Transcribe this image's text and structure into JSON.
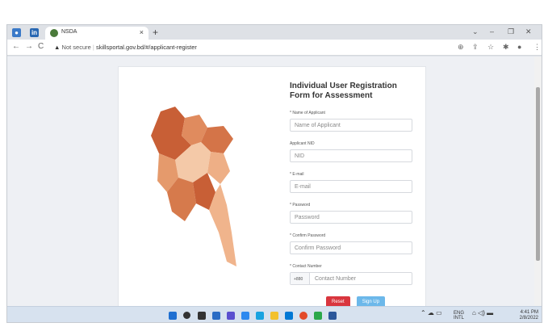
{
  "browser": {
    "tab_title": "NSDA",
    "tab_close": "×",
    "new_tab": "+",
    "window_controls": [
      "⌄",
      "–",
      "❐",
      "✕"
    ],
    "not_secure": "Not secure",
    "url": "skillsportal.gov.bd/#/applicant-register",
    "nav_back": "←",
    "nav_forward": "→",
    "nav_reload": "C",
    "toolbar_icons": [
      "zoom-icon",
      "share-icon",
      "star-icon",
      "extensions-icon",
      "profile-icon",
      "menu-icon"
    ]
  },
  "form": {
    "title": "Individual User Registration Form for Assessment",
    "fields": {
      "name": {
        "label": "* Name of Applicant",
        "placeholder": "Name of Applicant"
      },
      "nid": {
        "label": "Applicant NID",
        "placeholder": "NID"
      },
      "email": {
        "label": "* E-mail",
        "placeholder": "E-mail"
      },
      "password": {
        "label": "* Password",
        "placeholder": "Password"
      },
      "confirm": {
        "label": "* Confirm Password",
        "placeholder": "Confirm Password"
      },
      "contact": {
        "label": "* Contact Number",
        "prefix": "+880",
        "placeholder": "Contact Number"
      }
    },
    "reset_label": "Reset",
    "signup_label": "Sign Up"
  },
  "taskbar": {
    "lang_top": "ENG",
    "lang_bottom": "INTL",
    "time": "4:41 PM",
    "date": "2/8/2022"
  },
  "colors": {
    "reset": "#d9363e",
    "signup": "#6cb8ea",
    "map_dark": "#c85f36",
    "map_light": "#f4c9a8"
  }
}
